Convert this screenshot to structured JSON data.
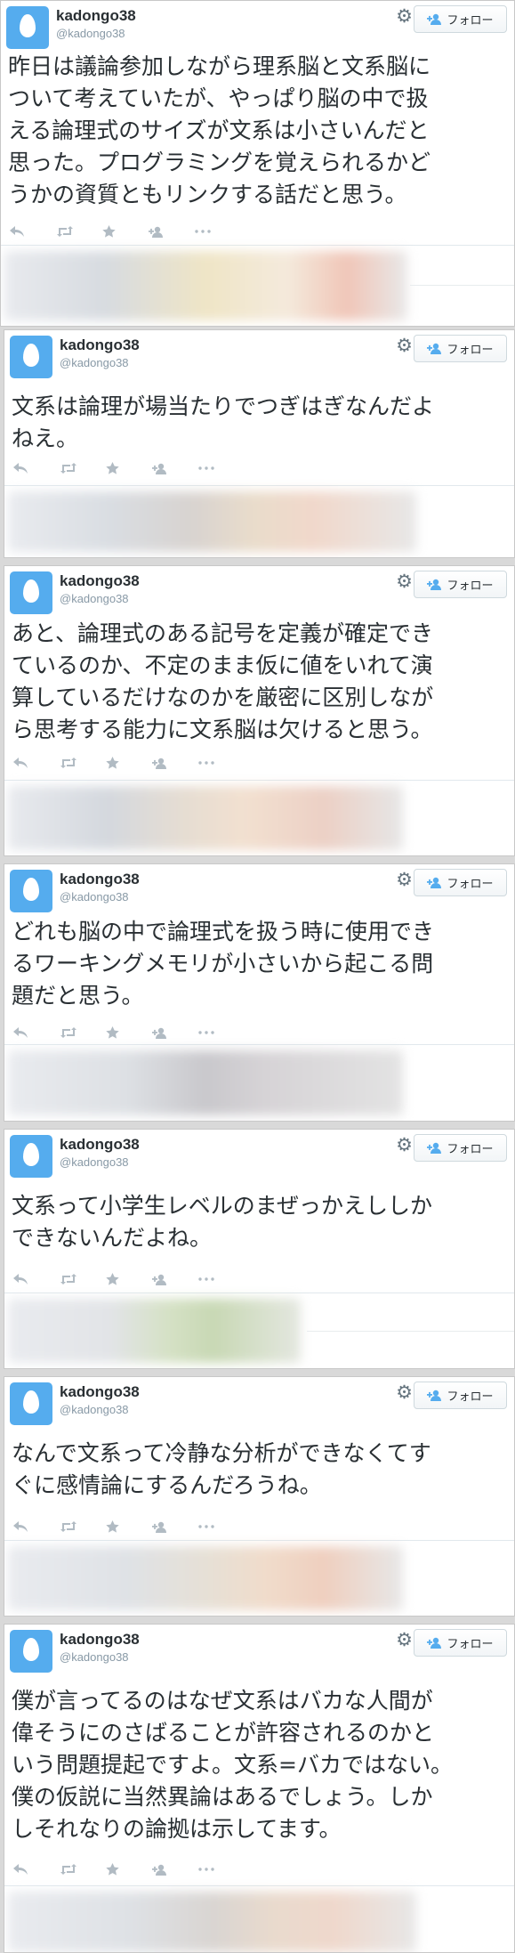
{
  "follow_label": "フォロー",
  "icons": {
    "gear": "gear-icon",
    "follow": "follow-user-icon",
    "reply": "reply-icon",
    "retweet": "retweet-icon",
    "favorite": "star-icon",
    "follow_action": "add-user-icon",
    "more": "more-icon",
    "avatar": "egg-avatar"
  },
  "colors": {
    "accent": "#55acee",
    "icon_gray": "#b1bbc3",
    "text": "#292f33",
    "handle": "#8899a6"
  },
  "tweets": [
    {
      "name": "kadongo38",
      "handle": "@kadongo38",
      "lines": [
        "昨日は議論参加しながら理系脳と文系脳に",
        "ついて考えていたが、やっぱり脳の中で扱",
        "える論理式のサイズが文系は小さいんだと",
        "思った。プログラミングを覚えられるかど",
        "うかの資質ともリンクする話だと思う。"
      ]
    },
    {
      "name": "kadongo38",
      "handle": "@kadongo38",
      "lines": [
        "文系は論理が場当たりでつぎはぎなんだよ",
        "ねえ。"
      ]
    },
    {
      "name": "kadongo38",
      "handle": "@kadongo38",
      "lines": [
        "あと、論理式のある記号を定義が確定でき",
        "ているのか、不定のまま仮に値をいれて演",
        "算しているだけなのかを厳密に区別しなが",
        "ら思考する能力に文系脳は欠けると思う。"
      ]
    },
    {
      "name": "kadongo38",
      "handle": "@kadongo38",
      "lines": [
        "どれも脳の中で論理式を扱う時に使用でき",
        "るワーキングメモリが小さいから起こる問",
        "題だと思う。"
      ]
    },
    {
      "name": "kadongo38",
      "handle": "@kadongo38",
      "lines": [
        "文系って小学生レベルのまぜっかえししか",
        "できないんだよね。"
      ]
    },
    {
      "name": "kadongo38",
      "handle": "@kadongo38",
      "lines": [
        "なんで文系って冷静な分析ができなくてす",
        "ぐに感情論にするんだろうね。"
      ]
    },
    {
      "name": "kadongo38",
      "handle": "@kadongo38",
      "lines": [
        "僕が言ってるのはなぜ文系はバカな人間が",
        "偉そうにのさばることが許容されるのかと",
        "いう問題提起ですよ。文系=バカではない。",
        "僕の仮説に当然異論はあるでしょう。しか",
        "しそれなりの論拠は示してます。"
      ]
    }
  ]
}
